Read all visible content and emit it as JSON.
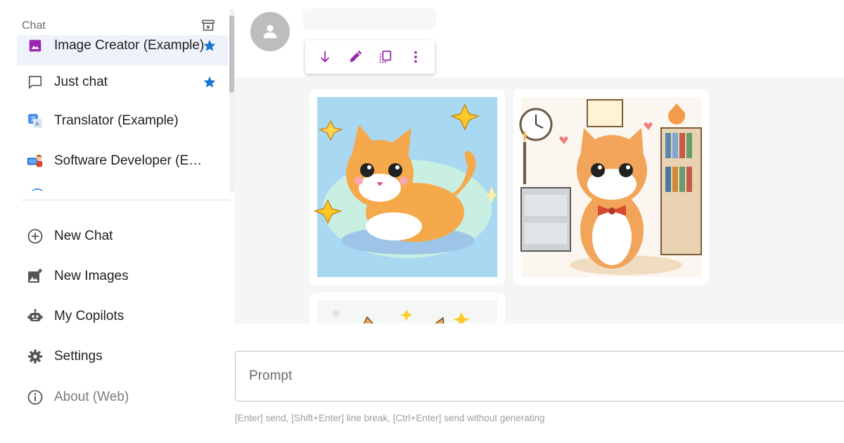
{
  "sidebar": {
    "section_title": "Chat",
    "chats": [
      {
        "label": "Image Creator (Example)",
        "icon": "image-icon",
        "starred": true,
        "active": true
      },
      {
        "label": "Just chat",
        "icon": "chat-bubble-icon",
        "starred": true,
        "active": false
      },
      {
        "label": "Translator (Example)",
        "icon": "translator-icon",
        "starred": false,
        "active": false
      },
      {
        "label": "Software Developer (Example)",
        "icon": "developer-icon",
        "starred": false,
        "active": false
      }
    ],
    "nav": [
      {
        "label": "New Chat",
        "icon": "add-circle-icon"
      },
      {
        "label": "New Images",
        "icon": "add-image-icon"
      },
      {
        "label": "My Copilots",
        "icon": "robot-icon"
      },
      {
        "label": "Settings",
        "icon": "gear-icon"
      },
      {
        "label": "About (Web)",
        "icon": "info-icon"
      }
    ]
  },
  "composer": {
    "placeholder": "Prompt",
    "hint": "[Enter] send, [Shift+Enter] line break, [Ctrl+Enter] send without generating"
  },
  "colors": {
    "accent": "#9c27b0",
    "star": "#1976d2",
    "active_bg": "#eef2fb"
  }
}
